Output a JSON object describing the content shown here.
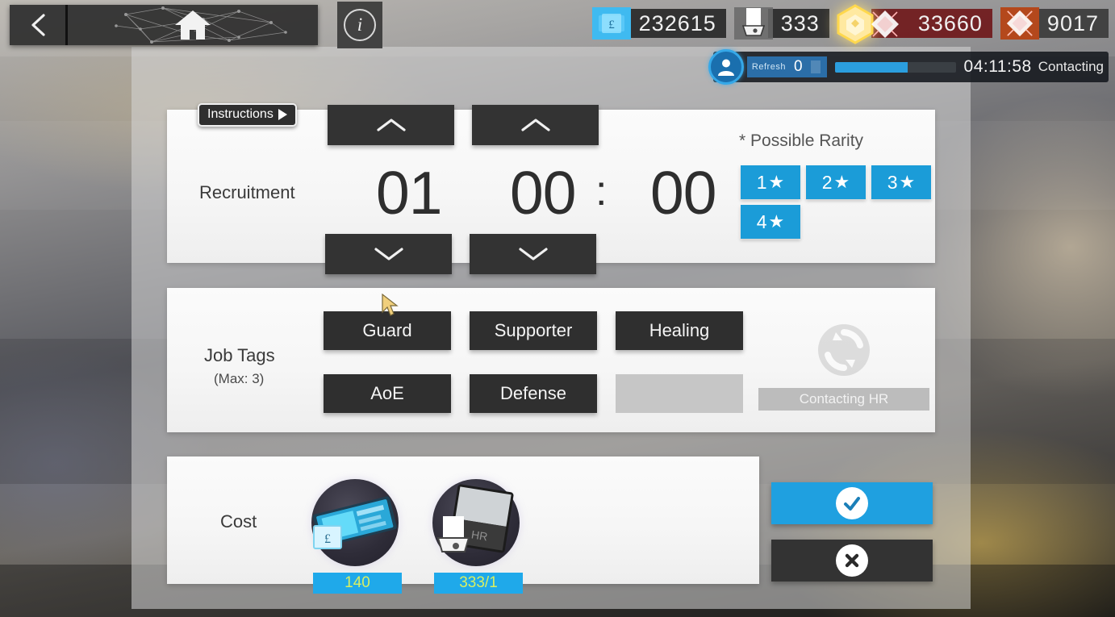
{
  "topbar": {
    "back_icon": "chevron-left-icon",
    "home_icon": "home-icon",
    "info_icon": "info-icon",
    "info_label": "i"
  },
  "counters": [
    {
      "id": "lmd",
      "icon": "lmd-icon",
      "value": "232615"
    },
    {
      "id": "permit",
      "icon": "recruitment-permit-icon",
      "value": "333"
    },
    {
      "id": "orundum",
      "icon": "orundum-icon",
      "value": "33660"
    },
    {
      "id": "originite",
      "icon": "originite-prime-icon",
      "value": "9017"
    }
  ],
  "refresh_strip": {
    "avatar_icon": "player-avatar-icon",
    "label": "Refresh",
    "count": "0",
    "progress_percent": 60,
    "time": "04:11:58",
    "state": "Contacting"
  },
  "instructions": {
    "label": "Instructions",
    "arrow_icon": "play-triangle-icon"
  },
  "recruitment": {
    "label": "Recruitment",
    "hours": "01",
    "minutes": "00",
    "seconds": "00",
    "separator": ":",
    "up_icon": "chevron-up-icon",
    "down_icon": "chevron-down-icon",
    "rarity_title": "* Possible Rarity",
    "rarity": [
      {
        "label": "1",
        "star": "★"
      },
      {
        "label": "2",
        "star": "★"
      },
      {
        "label": "3",
        "star": "★"
      },
      {
        "label": "4",
        "star": "★"
      }
    ]
  },
  "job_tags": {
    "label": "Job Tags",
    "sublabel": "(Max: 3)",
    "tags": [
      {
        "label": "Guard",
        "empty": false
      },
      {
        "label": "Supporter",
        "empty": false
      },
      {
        "label": "Healing",
        "empty": false
      },
      {
        "label": "AoE",
        "empty": false
      },
      {
        "label": "Defense",
        "empty": false
      },
      {
        "label": "",
        "empty": true
      }
    ],
    "refresh_icon": "refresh-cycle-icon",
    "contacting_hr_label": "Contacting HR"
  },
  "cost": {
    "label": "Cost",
    "items": [
      {
        "icon": "lmd-stack-icon",
        "badge": "140"
      },
      {
        "icon": "recruitment-permit-icon",
        "badge": "333/1"
      }
    ]
  },
  "actions": {
    "confirm_icon": "check-circle-icon",
    "cancel_icon": "close-circle-icon"
  },
  "colors": {
    "accent_blue": "#1fa0e0",
    "rarity_blue": "#1b9cd8",
    "badge_blue": "#1fa9ea",
    "badge_text": "#d8ef63",
    "dark_button": "#2f2f2f",
    "orundum_red": "#701a1c",
    "originite_orange": "#b4481c"
  }
}
